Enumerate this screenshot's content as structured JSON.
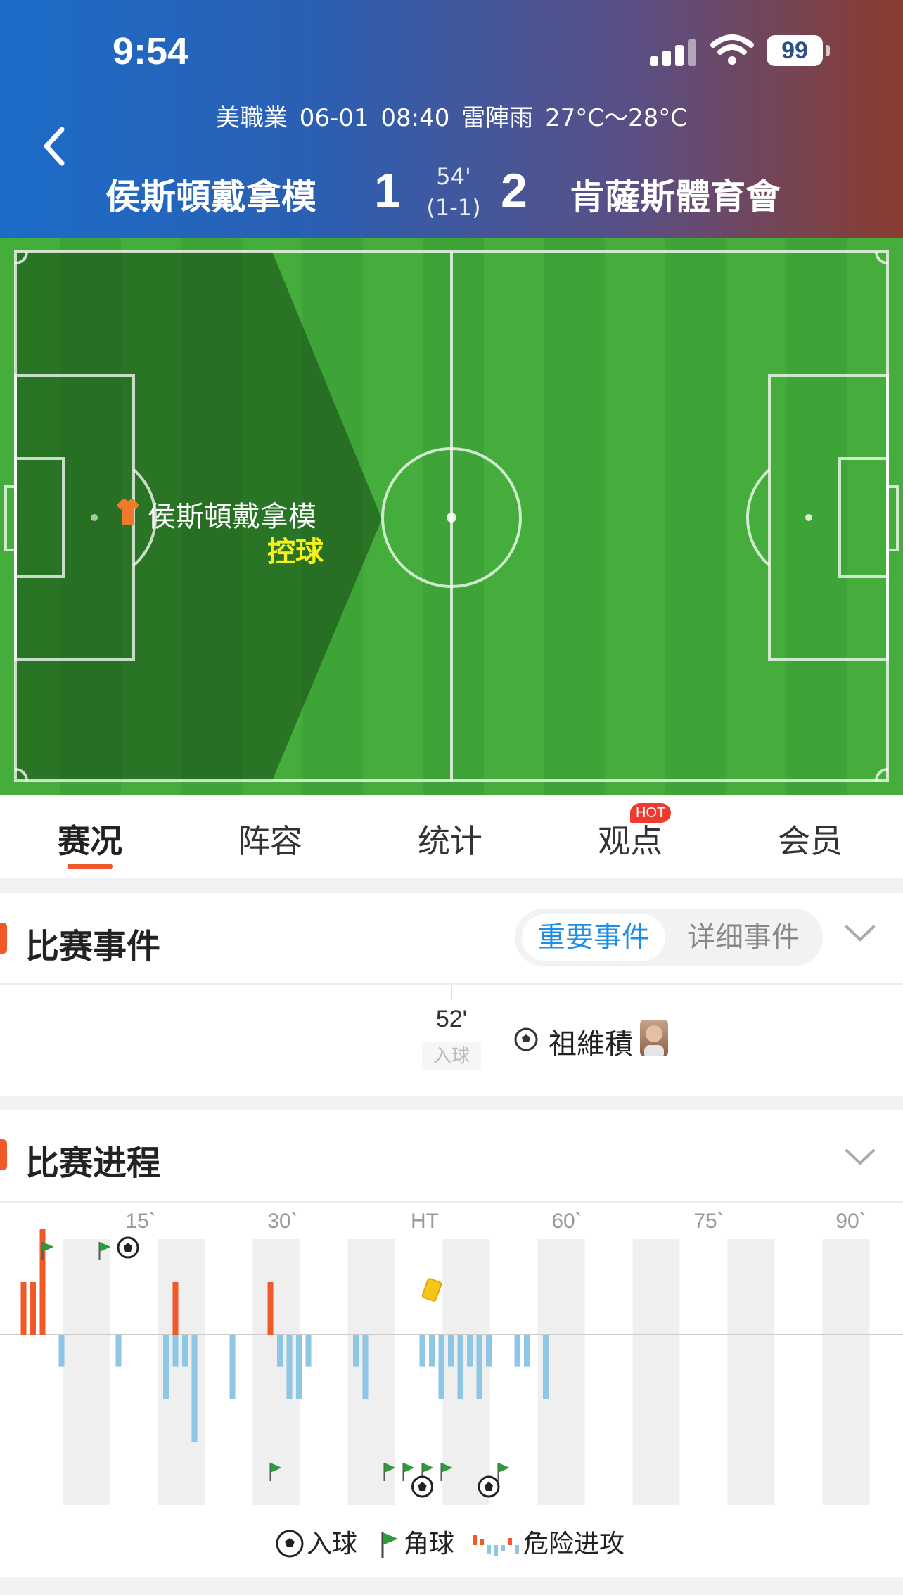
{
  "status_bar": {
    "time": "9:54",
    "battery": "99"
  },
  "match": {
    "info": "美職業  06-01 08:40  雷陣雨 27°C～28°C",
    "home_team": "侯斯頓戴拿模",
    "away_team": "肯薩斯體育會",
    "home_score": "1",
    "away_score": "2",
    "minute": "54'",
    "halftime_score": "(1-1)"
  },
  "pitch": {
    "possession_team": "侯斯頓戴拿模",
    "possession_label": "控球",
    "possession_depth": 0.42
  },
  "tabs": [
    {
      "label": "赛况",
      "active": true
    },
    {
      "label": "阵容"
    },
    {
      "label": "统计"
    },
    {
      "label": "观点",
      "badge": "HOT"
    },
    {
      "label": "会员"
    }
  ],
  "events": {
    "title": "比赛事件",
    "toggle": {
      "important": "重要事件",
      "detailed": "详细事件"
    },
    "items": [
      {
        "minute": "52'",
        "type": "入球",
        "player": "祖維積",
        "side": "away",
        "icon": "soccer-ball-icon"
      }
    ]
  },
  "progress": {
    "title": "比赛进程",
    "axis_labels": [
      "15`",
      "30`",
      "HT",
      "60`",
      "75`",
      "90`"
    ],
    "legend": {
      "goal": "入球",
      "corner": "角球",
      "attack": "危险进攻"
    },
    "colors": {
      "home": "#f05a28",
      "away": "#8ec6e6",
      "flag": "#2e9b3a"
    }
  },
  "chart_data": {
    "type": "bar",
    "title": "",
    "home_attacks": [
      {
        "minute": 1,
        "value": 0.5
      },
      {
        "minute": 2,
        "value": 0.5
      },
      {
        "minute": 3,
        "value": 1.0
      },
      {
        "minute": 17,
        "value": 0.5
      },
      {
        "minute": 27,
        "value": 0.5
      }
    ],
    "away_attacks": [
      {
        "minute": 5,
        "value": 0.3
      },
      {
        "minute": 11,
        "value": 0.3
      },
      {
        "minute": 16,
        "value": 0.6
      },
      {
        "minute": 17,
        "value": 0.3
      },
      {
        "minute": 18,
        "value": 0.3
      },
      {
        "minute": 19,
        "value": 1.0
      },
      {
        "minute": 23,
        "value": 0.6
      },
      {
        "minute": 28,
        "value": 0.3
      },
      {
        "minute": 29,
        "value": 0.6
      },
      {
        "minute": 30,
        "value": 0.6
      },
      {
        "minute": 31,
        "value": 0.3
      },
      {
        "minute": 36,
        "value": 0.3
      },
      {
        "minute": 37,
        "value": 0.6
      },
      {
        "minute": 43,
        "value": 0.3
      },
      {
        "minute": 44,
        "value": 0.3
      },
      {
        "minute": 45,
        "value": 0.6
      },
      {
        "minute": 46,
        "value": 0.3
      },
      {
        "minute": 47,
        "value": 0.6
      },
      {
        "minute": 48,
        "value": 0.3
      },
      {
        "minute": 49,
        "value": 0.6
      },
      {
        "minute": 50,
        "value": 0.3
      },
      {
        "minute": 53,
        "value": 0.3
      },
      {
        "minute": 54,
        "value": 0.3
      },
      {
        "minute": 56,
        "value": 0.6
      }
    ],
    "home_corners": [
      3,
      9
    ],
    "home_goals": [
      12
    ],
    "away_corners": [
      27,
      39,
      41,
      43,
      45,
      51
    ],
    "away_goals": [
      43,
      50
    ],
    "home_cards": [
      44
    ]
  }
}
